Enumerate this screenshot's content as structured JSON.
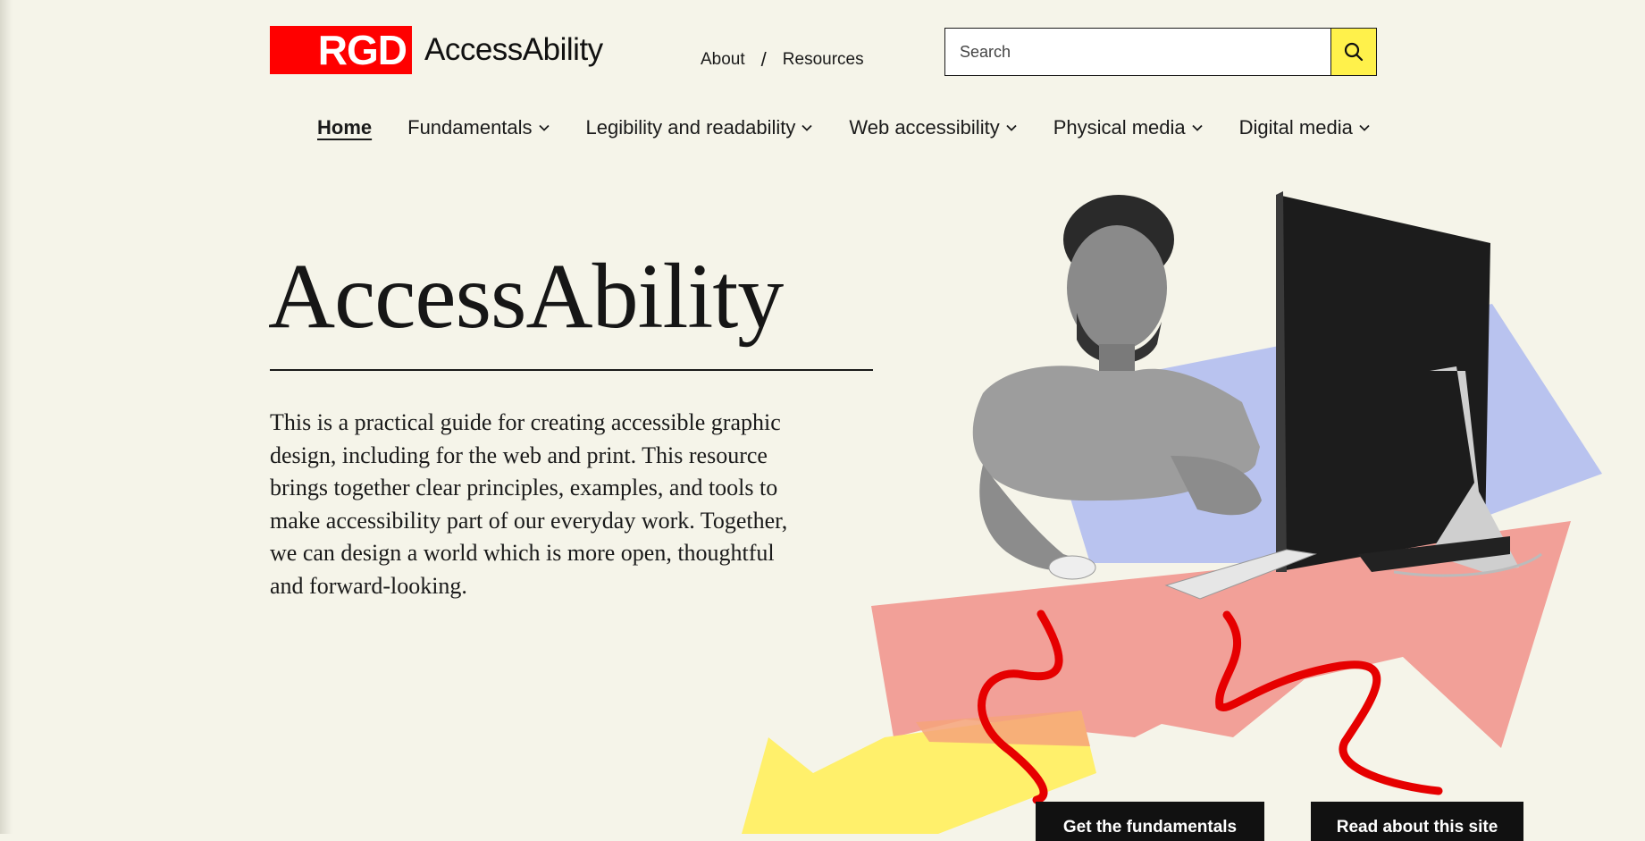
{
  "header": {
    "logo_mark": "RGD",
    "logo_text": "AccessAbility",
    "links": [
      {
        "label": "About"
      },
      {
        "label": "Resources"
      }
    ],
    "separator": "/",
    "search": {
      "placeholder": "Search",
      "value": ""
    }
  },
  "nav": {
    "items": [
      {
        "label": "Home",
        "active": true,
        "has_dropdown": false
      },
      {
        "label": "Fundamentals",
        "has_dropdown": true
      },
      {
        "label": "Legibility and readability",
        "has_dropdown": true
      },
      {
        "label": "Web accessibility",
        "has_dropdown": true
      },
      {
        "label": "Physical media",
        "has_dropdown": true
      },
      {
        "label": "Digital media",
        "has_dropdown": true
      }
    ]
  },
  "hero": {
    "title": "AccessAbility",
    "description": "This is a practical guide for creating accessible graphic design, including for the web and print. This resource brings together clear principles, examples, and tools to make accessibility part of our everyday work. Together, we can design a world which is more open, thoughtful and forward-looking."
  },
  "actions": {
    "primary": "Get the fundamentals",
    "secondary": "Read about this site"
  },
  "colors": {
    "background": "#f5f4e9",
    "brand_red": "#ff0000",
    "search_button": "#fff14b",
    "shape_pink": "#f2a098",
    "shape_blue": "#b9c3ef",
    "shape_yellow": "#fff06b",
    "squiggle_red": "#e60000"
  },
  "icons": {
    "search": "search-icon",
    "dropdown": "chevron-down-icon"
  }
}
